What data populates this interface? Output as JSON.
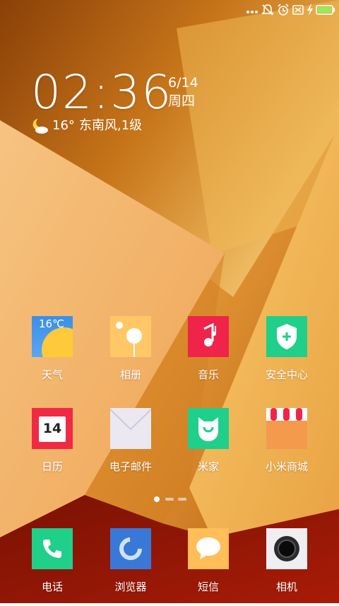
{
  "status_bar": {
    "icons": [
      "more-dots-icon",
      "mute-bell-icon",
      "alarm-icon",
      "sim-off-icon",
      "charging-icon",
      "battery-icon"
    ],
    "battery_color": "#8cf05a"
  },
  "clock": {
    "time": "02:36",
    "date": "6/14",
    "weekday": "周四"
  },
  "weather": {
    "icon": "moon-cloud-icon",
    "temperature": "16°",
    "wind": "东南风,1级"
  },
  "apps": [
    {
      "id": "weather",
      "label": "天气",
      "tile_text": "16℃"
    },
    {
      "id": "gallery",
      "label": "相册"
    },
    {
      "id": "music",
      "label": "音乐"
    },
    {
      "id": "security",
      "label": "安全中心"
    },
    {
      "id": "calendar",
      "label": "日历",
      "tile_text": "14"
    },
    {
      "id": "email",
      "label": "电子邮件"
    },
    {
      "id": "mihome",
      "label": "米家"
    },
    {
      "id": "mistore",
      "label": "小米商城"
    }
  ],
  "page_indicator": {
    "pages": 3,
    "current": 1
  },
  "dock": [
    {
      "id": "phone",
      "label": "电话"
    },
    {
      "id": "browser",
      "label": "浏览器"
    },
    {
      "id": "messages",
      "label": "短信"
    },
    {
      "id": "camera",
      "label": "相机"
    }
  ],
  "colors": {
    "weather_tile": "#3a8fe8",
    "music_tile": "#f0244a",
    "security_tile": "#1fcf8a",
    "calendar_tile": "#f02a44",
    "mihome_tile": "#1fcf8a",
    "phone_tile": "#1fcf8a",
    "browser_tile": "#3a78d8",
    "messages_tile": "#ffbe57"
  }
}
